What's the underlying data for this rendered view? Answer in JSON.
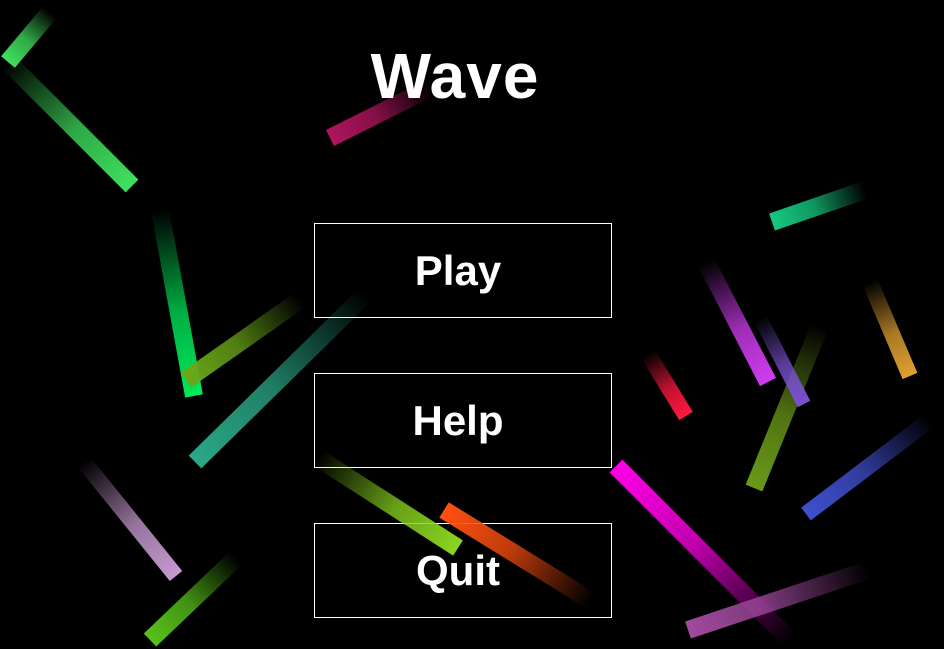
{
  "game": {
    "title": "Wave"
  },
  "menu": {
    "play_label": "Play",
    "help_label": "Help",
    "quit_label": "Quit"
  },
  "colors": {
    "background": "#000000",
    "text": "#ffffff",
    "button_border": "#ffffff"
  },
  "trail_colors": [
    "#3fe05f",
    "#b0155e",
    "#16c97f",
    "#00e85a",
    "#6aa719",
    "#2aa887",
    "#c69ad0",
    "#57c21a",
    "#8ad51f",
    "#ff5010",
    "#ff00e6",
    "#a04a9e",
    "#ff1840",
    "#d03cf0",
    "#6a9a19",
    "#e0a030",
    "#4050d0",
    "#7a50d0",
    "#20c890"
  ]
}
